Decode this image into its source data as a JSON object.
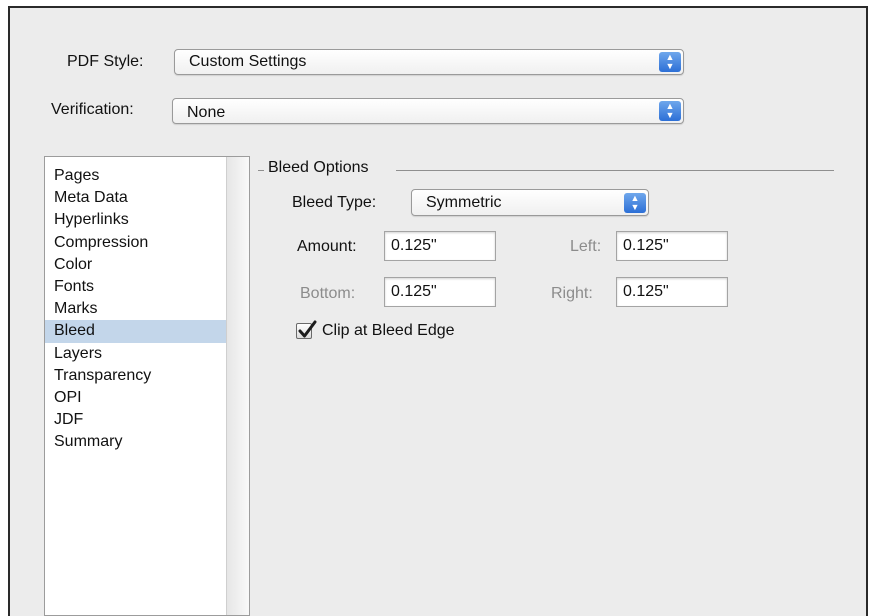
{
  "pdf_style": {
    "label": "PDF Style:",
    "value": "Custom Settings"
  },
  "verification": {
    "label": "Verification:",
    "value": "None"
  },
  "sidebar": {
    "items": [
      {
        "label": "Pages"
      },
      {
        "label": "Meta Data"
      },
      {
        "label": "Hyperlinks"
      },
      {
        "label": "Compression"
      },
      {
        "label": "Color"
      },
      {
        "label": "Fonts"
      },
      {
        "label": "Marks"
      },
      {
        "label": "Bleed",
        "selected": true
      },
      {
        "label": "Layers"
      },
      {
        "label": "Transparency"
      },
      {
        "label": "OPI"
      },
      {
        "label": "JDF"
      },
      {
        "label": "Summary"
      }
    ]
  },
  "bleed": {
    "group_title": "Bleed Options",
    "type_label": "Bleed Type:",
    "type_value": "Symmetric",
    "amount_label": "Amount:",
    "amount_value": "0.125\"",
    "left_label": "Left:",
    "left_value": "0.125\"",
    "bottom_label": "Bottom:",
    "bottom_value": "0.125\"",
    "right_label": "Right:",
    "right_value": "0.125\"",
    "clip_label": "Clip at Bleed Edge",
    "clip_checked": true
  },
  "colors": {
    "selection": "#c3d6ea",
    "popup_arrow": "#2c6fd6",
    "dialog_bg": "#ececec"
  },
  "icons": {
    "popup_arrows": "up-down-arrows-icon",
    "checkmark": "checkmark-icon"
  }
}
